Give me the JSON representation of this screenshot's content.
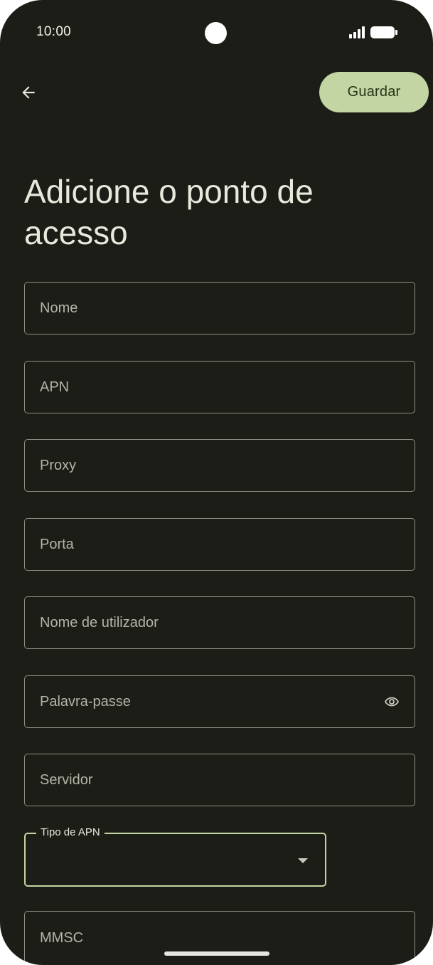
{
  "status_bar": {
    "time": "10:00"
  },
  "toolbar": {
    "save_label": "Guardar"
  },
  "page": {
    "title_line1": "Adicione o ponto de",
    "title_line2": "acesso"
  },
  "fields": {
    "name": {
      "placeholder": "Nome"
    },
    "apn": {
      "placeholder": "APN"
    },
    "proxy": {
      "placeholder": "Proxy"
    },
    "port": {
      "placeholder": "Porta"
    },
    "username": {
      "placeholder": "Nome de utilizador"
    },
    "password": {
      "placeholder": "Palavra-passe"
    },
    "server": {
      "placeholder": "Servidor"
    },
    "apn_type": {
      "label": "Tipo de APN",
      "value": ""
    },
    "mmsc": {
      "placeholder": "MMSC"
    }
  },
  "icons": {
    "back": "arrow-back-icon",
    "visibility": "eye-icon",
    "dropdown": "caret-down-icon"
  },
  "colors": {
    "background": "#1c1d17",
    "accent": "#c2d5a3",
    "text": "#e9e8dc",
    "outline": "#8e9184"
  }
}
